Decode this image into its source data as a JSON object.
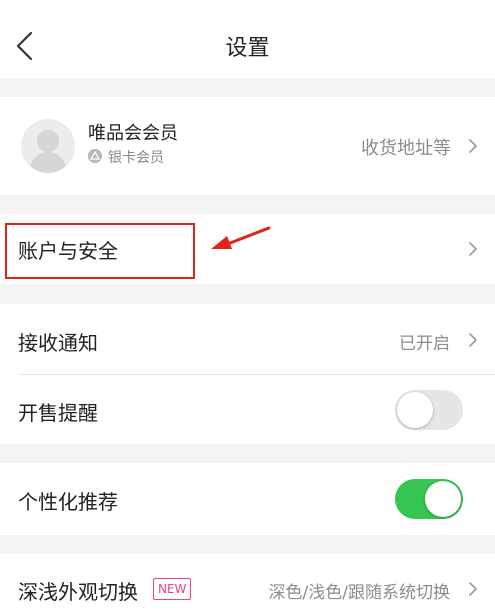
{
  "header": {
    "title": "设置"
  },
  "profile": {
    "name": "唯品会会员",
    "tier": "银卡会员",
    "address_link": "收货地址等"
  },
  "account": {
    "label": "账户与安全"
  },
  "notifications": {
    "receive_label": "接收通知",
    "receive_value": "已开启",
    "sale_reminder_label": "开售提醒",
    "sale_reminder_on": false
  },
  "personalization": {
    "label": "个性化推荐",
    "on": true
  },
  "theme": {
    "label": "深浅外观切换",
    "badge": "NEW",
    "value": "深色/浅色/跟随系统切换"
  },
  "colors": {
    "toggle_on": "#36c452",
    "toggle_off": "#e6e6e6",
    "highlight": "#e2231a",
    "badge": "#e9408a"
  },
  "icons": [
    "back-icon",
    "chevron-right-icon",
    "avatar-silhouette-icon",
    "tier-badge-icon"
  ]
}
